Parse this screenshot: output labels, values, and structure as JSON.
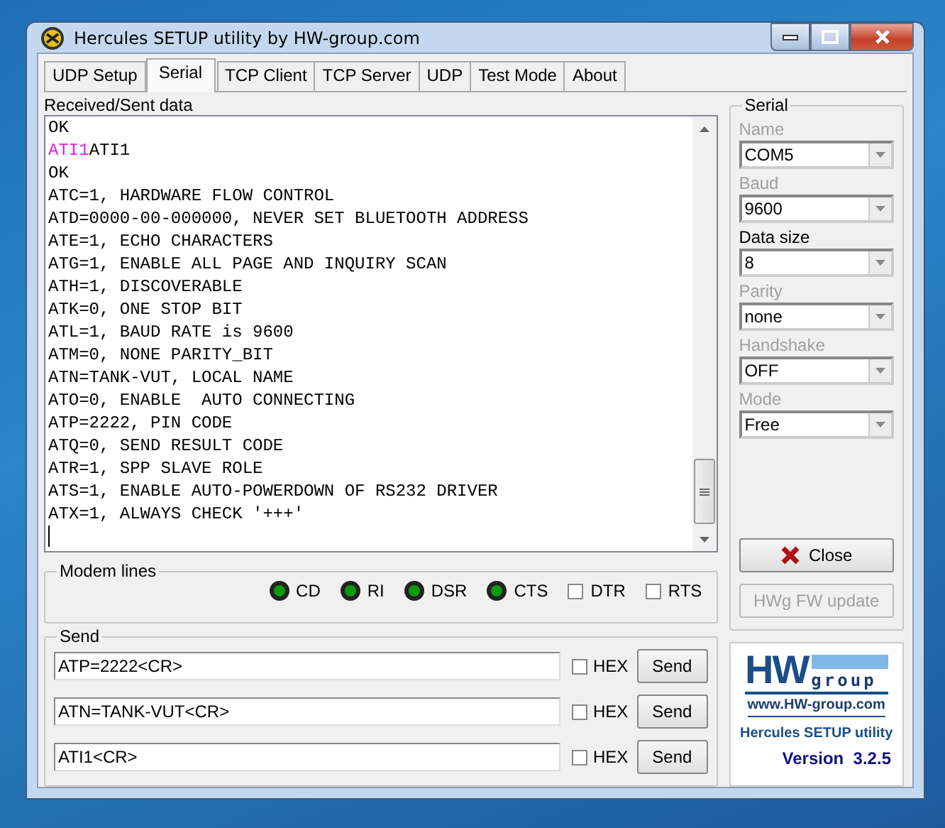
{
  "window": {
    "title": "Hercules SETUP utility by HW-group.com"
  },
  "tabs": [
    {
      "label": "UDP Setup",
      "selected": false
    },
    {
      "label": "Serial",
      "selected": true
    },
    {
      "label": "TCP Client",
      "selected": false
    },
    {
      "label": "TCP Server",
      "selected": false
    },
    {
      "label": "UDP",
      "selected": false
    },
    {
      "label": "Test Mode",
      "selected": false
    },
    {
      "label": "About",
      "selected": false
    }
  ],
  "received": {
    "label": "Received/Sent data",
    "lines": [
      {
        "text": "OK"
      },
      {
        "echo": "ATI1",
        "text": "ATI1"
      },
      {
        "text": "OK"
      },
      {
        "text": "ATC=1, HARDWARE FLOW CONTROL"
      },
      {
        "text": "ATD=0000-00-000000, NEVER SET BLUETOOTH ADDRESS"
      },
      {
        "text": "ATE=1, ECHO CHARACTERS"
      },
      {
        "text": "ATG=1, ENABLE ALL PAGE AND INQUIRY SCAN"
      },
      {
        "text": "ATH=1, DISCOVERABLE"
      },
      {
        "text": "ATK=0, ONE STOP BIT"
      },
      {
        "text": "ATL=1, BAUD RATE is 9600"
      },
      {
        "text": "ATM=0, NONE PARITY_BIT"
      },
      {
        "text": "ATN=TANK-VUT, LOCAL NAME"
      },
      {
        "text": "ATO=0, ENABLE  AUTO CONNECTING"
      },
      {
        "text": "ATP=2222, PIN CODE"
      },
      {
        "text": "ATQ=0, SEND RESULT CODE"
      },
      {
        "text": "ATR=1, SPP SLAVE ROLE"
      },
      {
        "text": "ATS=1, ENABLE AUTO-POWERDOWN OF RS232 DRIVER"
      },
      {
        "text": "ATX=1, ALWAYS CHECK '+++'"
      }
    ]
  },
  "modem_lines": {
    "title": "Modem lines",
    "signals": [
      {
        "kind": "led",
        "label": "CD",
        "on": true
      },
      {
        "kind": "led",
        "label": "RI",
        "on": true
      },
      {
        "kind": "led",
        "label": "DSR",
        "on": true
      },
      {
        "kind": "led",
        "label": "CTS",
        "on": true
      },
      {
        "kind": "checkbox",
        "label": "DTR",
        "checked": false
      },
      {
        "kind": "checkbox",
        "label": "RTS",
        "checked": false
      }
    ]
  },
  "send": {
    "title": "Send",
    "rows": [
      {
        "value": "ATP=2222<CR>",
        "hex_label": "HEX",
        "hex_checked": false,
        "button": "Send"
      },
      {
        "value": "ATN=TANK-VUT<CR>",
        "hex_label": "HEX",
        "hex_checked": false,
        "button": "Send"
      },
      {
        "value": "ATI1<CR>",
        "hex_label": "HEX",
        "hex_checked": false,
        "button": "Send"
      }
    ]
  },
  "serial": {
    "title": "Serial",
    "fields": [
      {
        "label": "Name",
        "value": "COM5",
        "disabled": true
      },
      {
        "label": "Baud",
        "value": "9600",
        "disabled": true
      },
      {
        "label": "Data size",
        "value": "8",
        "disabled": false
      },
      {
        "label": "Parity",
        "value": "none",
        "disabled": true
      },
      {
        "label": "Handshake",
        "value": "OFF",
        "disabled": true
      },
      {
        "label": "Mode",
        "value": "Free",
        "disabled": true
      }
    ],
    "buttons": [
      {
        "kind": "close",
        "label": "Close",
        "disabled": false
      },
      {
        "kind": "plain",
        "label": "HWg FW update",
        "disabled": true
      }
    ]
  },
  "logo": {
    "brand": "HW",
    "brand_suffix": "group",
    "url": "www.HW-group.com",
    "product": "Hercules SETUP utility",
    "version": "Version  3.2.5"
  }
}
